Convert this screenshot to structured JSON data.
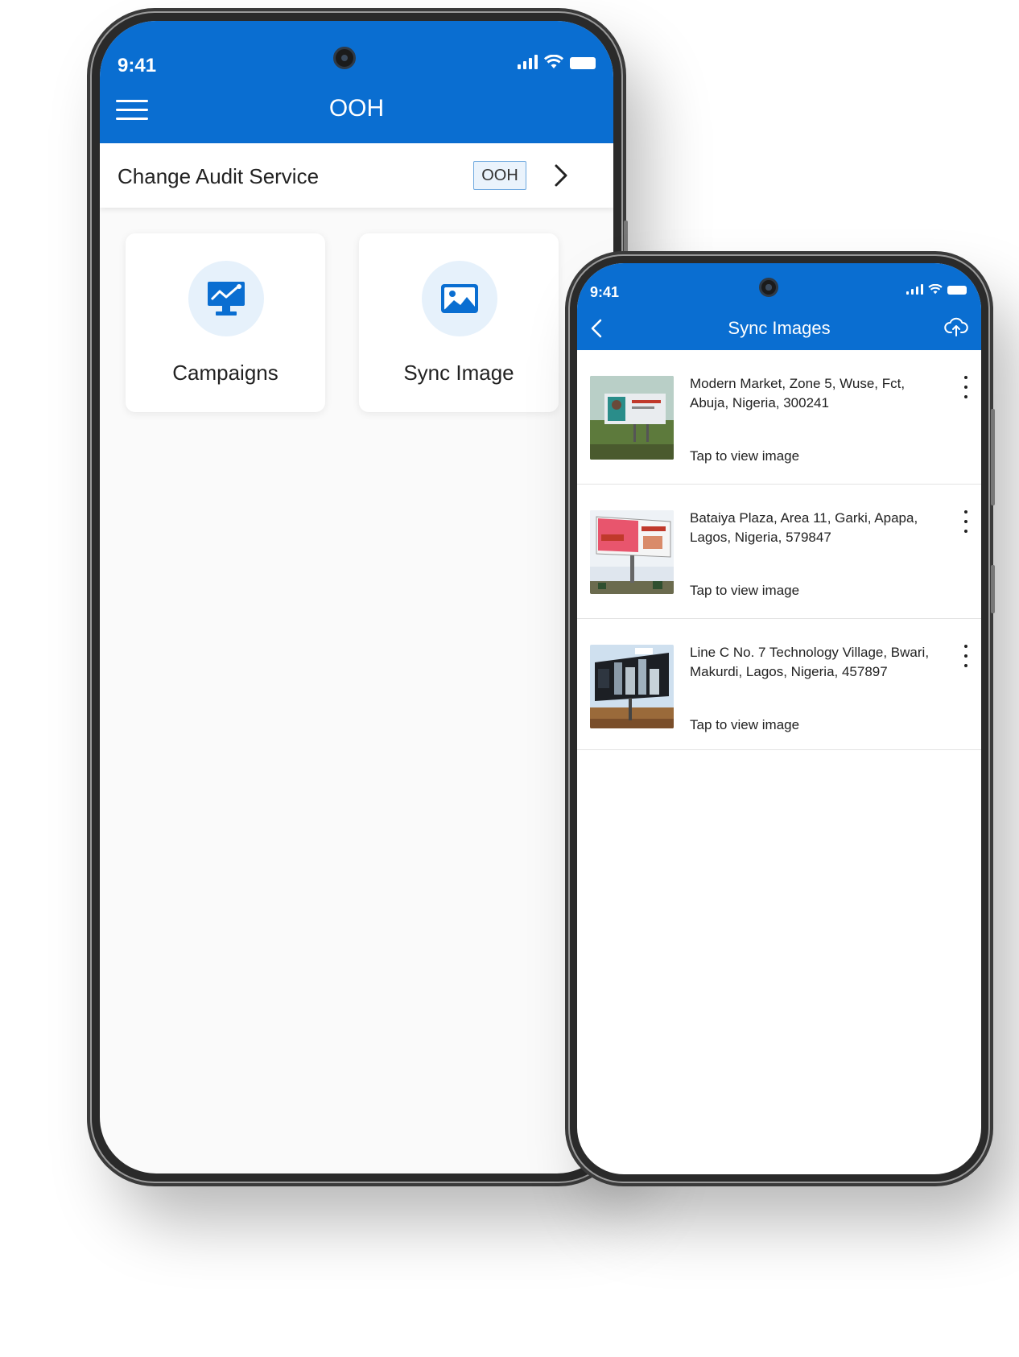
{
  "phone_main": {
    "status_time": "9:41",
    "title": "OOH",
    "audit_row": {
      "label": "Change Audit Service",
      "badge": "OOH"
    },
    "cards": [
      {
        "label": "Campaigns",
        "icon": "monitor-chart-icon"
      },
      {
        "label": "Sync Image",
        "icon": "image-icon"
      }
    ]
  },
  "phone_sync": {
    "status_time": "9:41",
    "title": "Sync Images",
    "items": [
      {
        "address": "Modern Market, Zone 5, Wuse, Fct, Abuja, Nigeria, 300241",
        "action": "Tap to view image"
      },
      {
        "address": "Bataiya Plaza, Area 11, Garki, Apapa, Lagos, Nigeria, 579847",
        "action": "Tap to view image"
      },
      {
        "address": "Line C No. 7 Technology Village, Bwari, Makurdi, Lagos, Nigeria, 457897",
        "action": "Tap to view image"
      }
    ]
  },
  "colors": {
    "primary": "#0a6ed1",
    "icon_bg": "#e6f1fb",
    "badge_border": "#6ea8df"
  }
}
